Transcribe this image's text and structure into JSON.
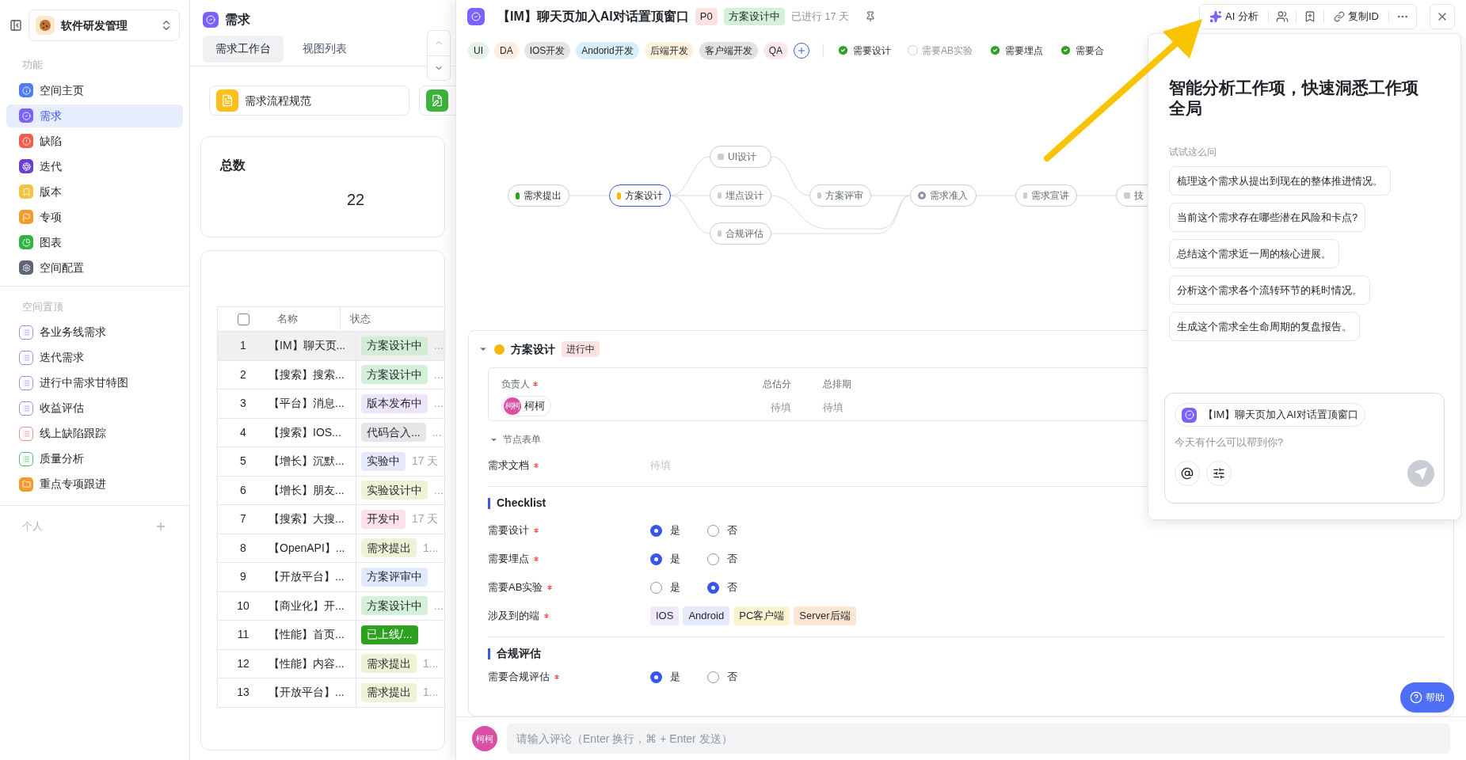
{
  "sidebar": {
    "space": "软件研发管理",
    "sections": [
      {
        "title": "功能",
        "items": [
          {
            "label": "空间主页",
            "color": "#4f7cff",
            "selected": false
          },
          {
            "label": "需求",
            "color": "#7b61ff",
            "selected": true
          },
          {
            "label": "缺陷",
            "color": "#f25c4a",
            "selected": false
          },
          {
            "label": "迭代",
            "color": "#6a3fd6",
            "selected": false
          },
          {
            "label": "版本",
            "color": "#f5c242",
            "selected": false
          },
          {
            "label": "专项",
            "color": "#f59b2e",
            "selected": false
          },
          {
            "label": "图表",
            "color": "#2fb344",
            "selected": false
          },
          {
            "label": "空间配置",
            "color": "#5f6673",
            "selected": false
          }
        ]
      },
      {
        "title": "空间置顶",
        "items": [
          {
            "label": "各业务线需求",
            "color": "#9b8cff",
            "kind": "list",
            "selected": false
          },
          {
            "label": "迭代需求",
            "color": "#9b8cff",
            "kind": "list",
            "selected": false
          },
          {
            "label": "进行中需求甘特图",
            "color": "#9b8cff",
            "kind": "list",
            "selected": false
          },
          {
            "label": "收益评估",
            "color": "#9b8cff",
            "kind": "list",
            "selected": false
          },
          {
            "label": "线上缺陷跟踪",
            "color": "#f08a8a",
            "kind": "list",
            "selected": false
          },
          {
            "label": "质量分析",
            "color": "#4cc26a",
            "kind": "list",
            "selected": false
          },
          {
            "label": "重点专项跟进",
            "color": "#f59b2e",
            "kind": "folder",
            "selected": false
          }
        ]
      }
    ],
    "personal": "个人"
  },
  "list_panel": {
    "title": "需求",
    "tabs": [
      {
        "label": "需求工作台",
        "selected": true
      },
      {
        "label": "视图列表",
        "selected": false
      }
    ],
    "shortcut": "需求流程规范",
    "stat": {
      "label": "总数",
      "value": "22"
    },
    "table": {
      "columns": [
        "名称",
        "状态"
      ],
      "all_checked": false,
      "rows": [
        {
          "index": "1",
          "name": "【IM】聊天页...",
          "status": "方案设计中",
          "color": "#d3ecd8",
          "column_3": "...",
          "selected": true
        },
        {
          "index": "2",
          "name": "【搜索】搜索...",
          "status": "方案设计中",
          "color": "#d5f0da",
          "column_3": "...",
          "selected": false
        },
        {
          "index": "3",
          "name": "【平台】消息...",
          "status": "版本发布中",
          "color": "#ede6fb",
          "column_3": "...",
          "selected": false
        },
        {
          "index": "4",
          "name": "【搜索】IOS...",
          "status": "代码合入...",
          "color": "#e6e6e8",
          "column_3": "...",
          "selected": false
        },
        {
          "index": "5",
          "name": "【增长】沉默...",
          "status": "实验中",
          "color": "#e6e8fb",
          "column_3": "17 天",
          "selected": false
        },
        {
          "index": "6",
          "name": "【增长】朋友...",
          "status": "实验设计中",
          "color": "#eef3d6",
          "column_3": "...",
          "selected": false
        },
        {
          "index": "7",
          "name": "【搜索】大搜...",
          "status": "开发中",
          "color": "#fde1ea",
          "column_3": "17 天",
          "selected": false
        },
        {
          "index": "8",
          "name": "【OpenAPI】...",
          "status": "需求提出",
          "color": "#eef3d6",
          "column_3": "1...",
          "selected": false
        },
        {
          "index": "9",
          "name": "【开放平台】...",
          "status": "方案评审中",
          "color": "#e1eafd",
          "selected": false
        },
        {
          "index": "10",
          "name": "【商业化】开...",
          "status": "方案设计中",
          "color": "#d5f0da",
          "column_3": "...",
          "selected": false
        },
        {
          "index": "11",
          "name": "【性能】首页...",
          "status": "已上线/...",
          "color": "#2ea121",
          "selected": false
        },
        {
          "index": "12",
          "name": "【性能】内容...",
          "status": "需求提出",
          "color": "#eef3d6",
          "column_3": "1...",
          "selected": false
        },
        {
          "index": "13",
          "name": "【开放平台】...",
          "status": "需求提出",
          "color": "#eef3d6",
          "column_3": "1...",
          "selected": false
        }
      ]
    }
  },
  "detail": {
    "title": "【IM】聊天页加入AI对话置顶窗口",
    "priority": "P0",
    "status": "方案设计中",
    "elapsed": "已进行 17 天",
    "toolbar": {
      "ai": "AI 分析",
      "copy": "复制ID"
    },
    "tags": [
      {
        "label": "UI",
        "color": "#e4f3e6"
      },
      {
        "label": "DA",
        "color": "#fdeee0"
      },
      {
        "label": "IOS开发",
        "color": "#e4e4e7"
      },
      {
        "label": "Andorid开发",
        "color": "#d6eff9"
      },
      {
        "label": "后端开发",
        "color": "#fdf3dc"
      },
      {
        "label": "客户端开发",
        "color": "#e2e2e5"
      },
      {
        "label": "QA",
        "color": "#fbe6ee"
      }
    ],
    "checks": [
      {
        "label": "需要设计",
        "checked": true
      },
      {
        "label": "需要AB实验",
        "checked": false
      },
      {
        "label": "需要埋点",
        "checked": true
      },
      {
        "label": "需要合",
        "checked": true
      }
    ],
    "flow": [
      {
        "label": "需求提出",
        "kind": "done"
      },
      {
        "label": "方案设计",
        "kind": "current"
      },
      {
        "label": "UI设计",
        "kind": "pending"
      },
      {
        "label": "埋点设计",
        "kind": "pending"
      },
      {
        "label": "合规评估",
        "kind": "pending"
      },
      {
        "label": "方案评审",
        "kind": "pending"
      },
      {
        "label": "需求准入",
        "kind": "gate"
      },
      {
        "label": "需求宣讲",
        "kind": "pending"
      },
      {
        "label": "技",
        "kind": "pending"
      }
    ],
    "stage": {
      "title": "方案设计",
      "badge": "进行中",
      "expanded": true,
      "fields": [
        {
          "label": "负责人",
          "required": true
        },
        {
          "label": "总估分",
          "required": false
        },
        {
          "label": "总排期",
          "required": false
        }
      ],
      "owner": {
        "avatar_text": "柯柯",
        "name": "柯柯"
      },
      "score": "待填",
      "schedule": "待填",
      "form_title": "节点表单",
      "doc": {
        "label": "需求文档",
        "value": "待填",
        "required": true
      },
      "checklist_title": "Checklist",
      "radios": [
        {
          "label": "需要设计",
          "required": true,
          "options": [
            {
              "label": "是",
              "selected": true
            },
            {
              "label": "否",
              "selected": false
            }
          ]
        },
        {
          "label": "需要埋点",
          "required": true,
          "options": [
            {
              "label": "是",
              "selected": true
            },
            {
              "label": "否",
              "selected": false
            }
          ]
        },
        {
          "label": "需要AB实验",
          "required": true,
          "options": [
            {
              "label": "是",
              "selected": false
            },
            {
              "label": "否",
              "selected": true
            }
          ]
        }
      ],
      "platforms": {
        "label": "涉及到的端",
        "required": true,
        "items": [
          {
            "label": "IOS",
            "color": "#efe9fb"
          },
          {
            "label": "Android",
            "color": "#e6e8fb"
          },
          {
            "label": "PC客户端",
            "color": "#fdf3d3"
          },
          {
            "label": "Server后端",
            "color": "#fbe6d3"
          }
        ]
      },
      "compliance_title": "合规评估",
      "compliance": {
        "label": "需要合规评估",
        "required": true,
        "options": [
          {
            "label": "是",
            "selected": true
          },
          {
            "label": "否",
            "selected": false
          }
        ]
      }
    },
    "comment": {
      "avatar_text": "柯柯",
      "placeholder": "请输入评论（Enter 换行，⌘ + Enter 发送）"
    },
    "help": "帮助"
  },
  "ai_panel": {
    "heading": "智能分析工作项，快速洞悉工作项全局",
    "hint": "试试这么问",
    "suggestions": [
      "梳理这个需求从提出到现在的整体推进情况。",
      "当前这个需求存在哪些潜在风险和卡点?",
      "总结这个需求近一周的核心进展。",
      "分析这个需求各个流转环节的耗时情况。",
      "生成这个需求全生命周期的复盘报告。"
    ],
    "context": "【IM】聊天页加入AI对话置顶窗口",
    "placeholder": "今天有什么可以帮到你?"
  }
}
